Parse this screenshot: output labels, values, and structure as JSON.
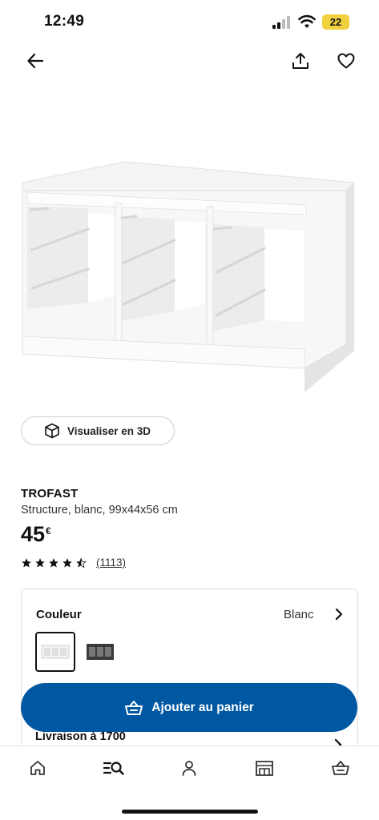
{
  "status_bar": {
    "time": "12:49",
    "battery": "22"
  },
  "nav": {
    "back_icon": "arrow-left-icon",
    "share_icon": "share-icon",
    "favorite_icon": "heart-icon"
  },
  "product": {
    "name": "TROFAST",
    "description": "Structure, blanc, 99x44x56 cm",
    "price": "45",
    "currency": "€",
    "rating": 4.5,
    "review_count": "(1113)"
  },
  "view3d": {
    "label": "Visualiser en 3D",
    "icon": "cube-icon"
  },
  "color": {
    "title": "Couleur",
    "selected": "Blanc",
    "options": [
      "white",
      "dark-grey"
    ]
  },
  "delivery": {
    "label": "Livraison à 1700"
  },
  "cart_button": {
    "label": "Ajouter au panier",
    "icon": "basket-icon"
  },
  "tabs": [
    "home-icon",
    "search-list-icon",
    "profile-icon",
    "store-icon",
    "basket-icon"
  ],
  "colors": {
    "primary": "#0058a3",
    "battery": "#f2d13f"
  }
}
